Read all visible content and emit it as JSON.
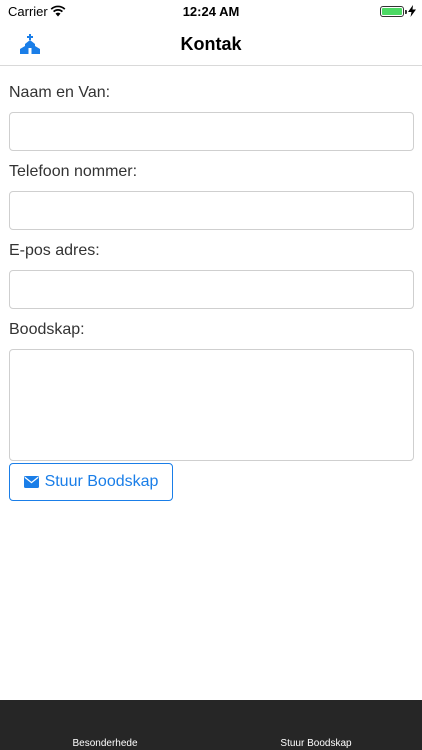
{
  "status_bar": {
    "carrier": "Carrier",
    "time": "12:24 AM"
  },
  "nav": {
    "title": "Kontak",
    "icon": "church-icon",
    "accent_color": "#1a7ee8"
  },
  "form": {
    "name_label": "Naam en Van:",
    "name_value": "",
    "phone_label": "Telefoon nommer:",
    "phone_value": "",
    "email_label": "E-pos adres:",
    "email_value": "",
    "message_label": "Boodskap:",
    "message_value": ""
  },
  "submit": {
    "label": "Stuur Boodskap",
    "icon": "envelope-icon"
  },
  "tab_bar": {
    "items": [
      {
        "label": "Besonderhede"
      },
      {
        "label": "Stuur Boodskap"
      }
    ],
    "background": "#262626"
  }
}
